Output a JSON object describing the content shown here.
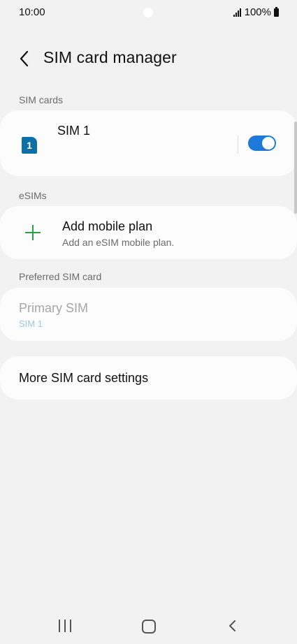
{
  "status_bar": {
    "time": "10:00",
    "battery": "100%"
  },
  "header": {
    "title": "SIM card manager"
  },
  "sections": {
    "sim_cards_label": "SIM cards",
    "esims_label": "eSIMs",
    "preferred_label": "Preferred SIM card"
  },
  "sim_card": {
    "name": "SIM 1",
    "icon_number": "1",
    "enabled": true
  },
  "esim": {
    "title": "Add mobile plan",
    "subtitle": "Add an eSIM mobile plan."
  },
  "preferred": {
    "title": "Primary SIM",
    "value": "SIM 1"
  },
  "more_settings": {
    "title": "More SIM card settings"
  },
  "colors": {
    "accent": "#1e79d8",
    "sim_icon": "#0d6fa8",
    "plus_icon": "#2aa04a",
    "disabled_text": "#a6a6a6",
    "disabled_value": "#9ec5ea"
  },
  "icons": {
    "back": "back-arrow-icon",
    "add": "plus-icon",
    "sim": "sim-card-icon",
    "nav_recent": "recent-apps-icon",
    "nav_home": "home-icon",
    "nav_back": "back-chevron-icon"
  }
}
